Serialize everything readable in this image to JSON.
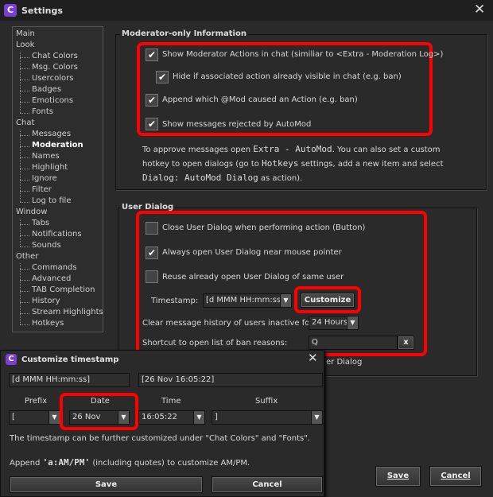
{
  "window": {
    "title": "Settings",
    "app_icon": "C"
  },
  "tree": {
    "items": [
      {
        "label": "Main",
        "level": 0
      },
      {
        "label": "Look",
        "level": 0
      },
      {
        "label": "Chat Colors",
        "level": 1
      },
      {
        "label": "Msg. Colors",
        "level": 1
      },
      {
        "label": "Usercolors",
        "level": 1
      },
      {
        "label": "Badges",
        "level": 1
      },
      {
        "label": "Emoticons",
        "level": 1
      },
      {
        "label": "Fonts",
        "level": 1
      },
      {
        "label": "Chat",
        "level": 0
      },
      {
        "label": "Messages",
        "level": 1
      },
      {
        "label": "Moderation",
        "level": 1,
        "selected": true
      },
      {
        "label": "Names",
        "level": 1
      },
      {
        "label": "Highlight",
        "level": 1
      },
      {
        "label": "Ignore",
        "level": 1
      },
      {
        "label": "Filter",
        "level": 1
      },
      {
        "label": "Log to file",
        "level": 1
      },
      {
        "label": "Window",
        "level": 0
      },
      {
        "label": "Tabs",
        "level": 1
      },
      {
        "label": "Notifications",
        "level": 1
      },
      {
        "label": "Sounds",
        "level": 1
      },
      {
        "label": "Other",
        "level": 0
      },
      {
        "label": "Commands",
        "level": 1
      },
      {
        "label": "Advanced",
        "level": 1
      },
      {
        "label": "TAB Completion",
        "level": 1
      },
      {
        "label": "History",
        "level": 1
      },
      {
        "label": "Stream Highlights",
        "level": 1
      },
      {
        "label": "Hotkeys",
        "level": 1
      }
    ]
  },
  "moderator": {
    "title": "Moderator-only Information",
    "options": [
      {
        "label": "Show Moderator Actions in chat (similiar to <Extra - Moderation Log>)",
        "checked": true
      },
      {
        "label": "Hide if associated action already visible in chat (e.g. ban)",
        "checked": true
      },
      {
        "label": "Append which @Mod caused an Action (e.g. ban)",
        "checked": true
      },
      {
        "label": "Show messages rejected by AutoMod",
        "checked": true
      }
    ],
    "info": {
      "p1": "To approve messages open ",
      "c1": "Extra - AutoMod",
      "p2": ". You can also set a custom",
      "p3": "hotkey to open dialogs (go to ",
      "c2": "Hotkeys",
      "p4": " settings, add a new item and select",
      "c3": "Dialog: AutoMod Dialog",
      "p5": " as action)."
    }
  },
  "user_dialog": {
    "title": "User Dialog",
    "options": [
      {
        "label": "Close User Dialog when performing action (Button)",
        "checked": false
      },
      {
        "label": "Always open User Dialog near mouse pointer",
        "checked": true
      },
      {
        "label": "Reuse already open User Dialog of same user",
        "checked": false
      }
    ],
    "timestamp_label": "Timestamp:",
    "timestamp_value": "[d MMM HH:mm:ss]",
    "customize": "Customize",
    "clear_label": "Clear message history of users inactive for:",
    "clear_value": "24 Hours",
    "shortcut_label": "Shortcut to open list of ban reasons:",
    "shortcut_value": "Q",
    "shortcut_clear": "x",
    "partial_text": "er Dialog"
  },
  "footer": {
    "save": "Save",
    "cancel": "Cancel"
  },
  "customize_dialog": {
    "title": "Customize timestamp",
    "app_icon": "C",
    "format": "[d MMM HH:mm:ss]",
    "preview": "[26 Nov 16:05:22]",
    "prefix_label": "Prefix",
    "date_label": "Date",
    "time_label": "Time",
    "suffix_label": "Suffix",
    "prefix": "[",
    "date": "26 Nov",
    "time": "16:05:22",
    "suffix": "]",
    "note1": "The timestamp can be further customized under \"Chat Colors\" and \"Fonts\".",
    "note2a": "Append ",
    "note2code": "'a:AM/PM'",
    "note2b": " (including quotes) to customize AM/PM.",
    "save": "Save",
    "cancel": "Cancel"
  },
  "colors": {
    "highlight": "#ff0000",
    "app_icon": "#7b3fd0"
  }
}
